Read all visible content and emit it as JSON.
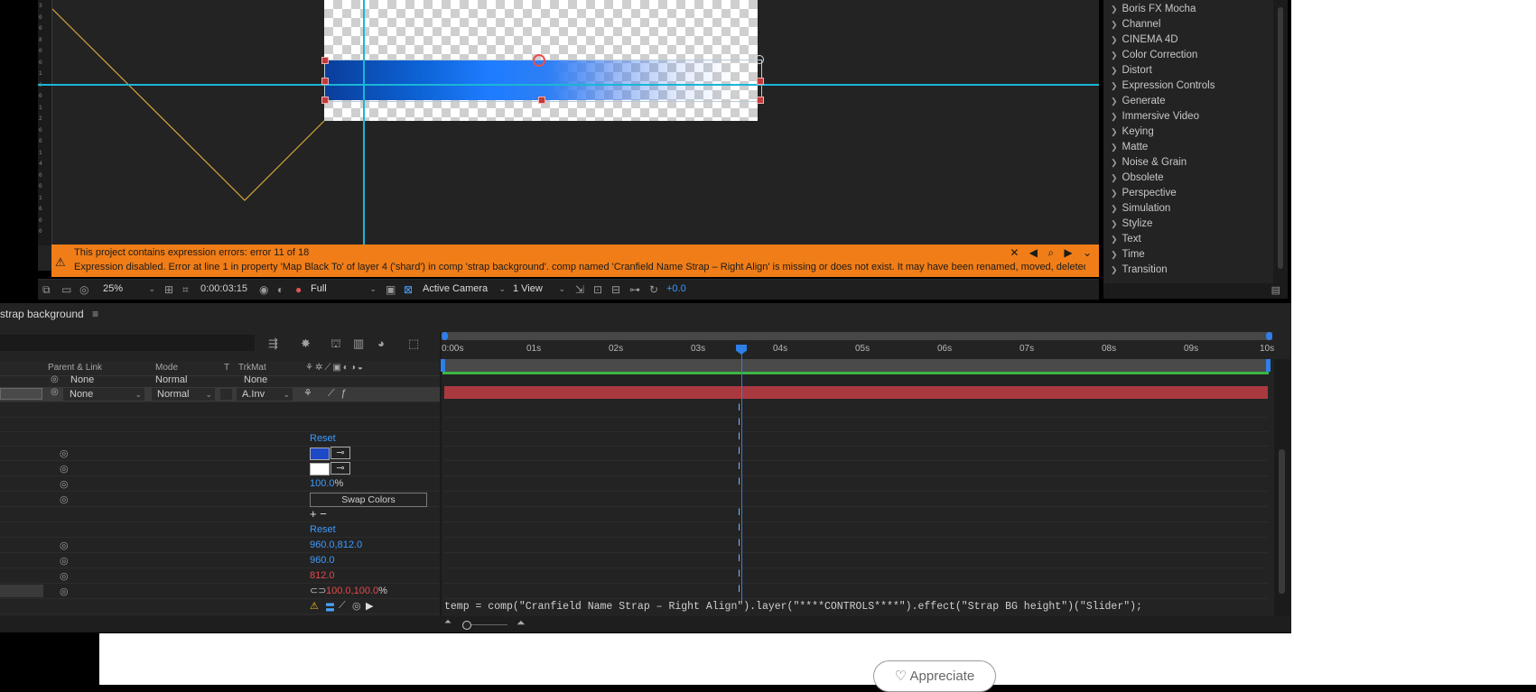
{
  "viewer": {
    "ruler_marks": [
      "3",
      "0",
      "0",
      "8",
      "0",
      "0",
      "1",
      "0",
      "0",
      "1",
      "2",
      "0",
      "0",
      "1",
      "4",
      "0",
      "0",
      "1",
      "6",
      "0",
      "0"
    ],
    "error": {
      "line1": "This project contains expression errors: error 11 of 18",
      "line2": "Expression disabled. Error at line 1 in property 'Map Black To' of layer 4 ('shard') in comp 'strap background'.  comp named 'Cranfield Name Strap – Right Align' is missing or does not exist. It may have been renamed, moved, deleted",
      "controls": "✕ ◀ ⌕ ▶ ⌄"
    },
    "toolbar": {
      "zoom": "25%",
      "timecode": "0:00:03:15",
      "resolution": "Full",
      "camera": "Active Camera",
      "views": "1 View",
      "exposure": "+0.0"
    }
  },
  "effects": {
    "items": [
      "Boris FX Mocha",
      "Channel",
      "CINEMA 4D",
      "Color Correction",
      "Distort",
      "Expression Controls",
      "Generate",
      "Immersive Video",
      "Keying",
      "Matte",
      "Noise & Grain",
      "Obsolete",
      "Perspective",
      "Simulation",
      "Stylize",
      "Text",
      "Time",
      "Transition"
    ]
  },
  "timeline": {
    "tab": "strap background",
    "tab_menu": "≡",
    "columns": {
      "parent": "Parent & Link",
      "mode": "Mode",
      "t": "T",
      "trkmat": "TrkMat"
    },
    "layer_prev": {
      "parent": "None",
      "mode": "Normal",
      "trkmat": "None"
    },
    "layer": {
      "parent": "None",
      "mode": "Normal",
      "trkmat": "A.Inv"
    },
    "ticks": [
      "0:00s",
      "01s",
      "02s",
      "03s",
      "04s",
      "05s",
      "06s",
      "07s",
      "08s",
      "09s",
      "10s"
    ],
    "props": {
      "reset1": "Reset",
      "opacity": "100.0",
      "opacity_unit": "%",
      "swap": "Swap Colors",
      "reset2": "Reset",
      "position": "960.0,812.0",
      "x": "960.0",
      "y": "812.0",
      "scale_x": "100.0",
      "scale_y": "100.0",
      "scale_unit": "%",
      "addrem": "+ −"
    },
    "expression": "temp = comp(\"Cranfield Name Strap – Right Align\").layer(\"****CONTROLS****\").effect(\"Strap BG height\")(\"Slider\");"
  },
  "page": {
    "appreciate": "Appreciate"
  },
  "colors": {
    "accent": "#1ab6d6",
    "error": "#f07d17",
    "layer": "#a9393f",
    "cti": "#2e7fe8"
  }
}
